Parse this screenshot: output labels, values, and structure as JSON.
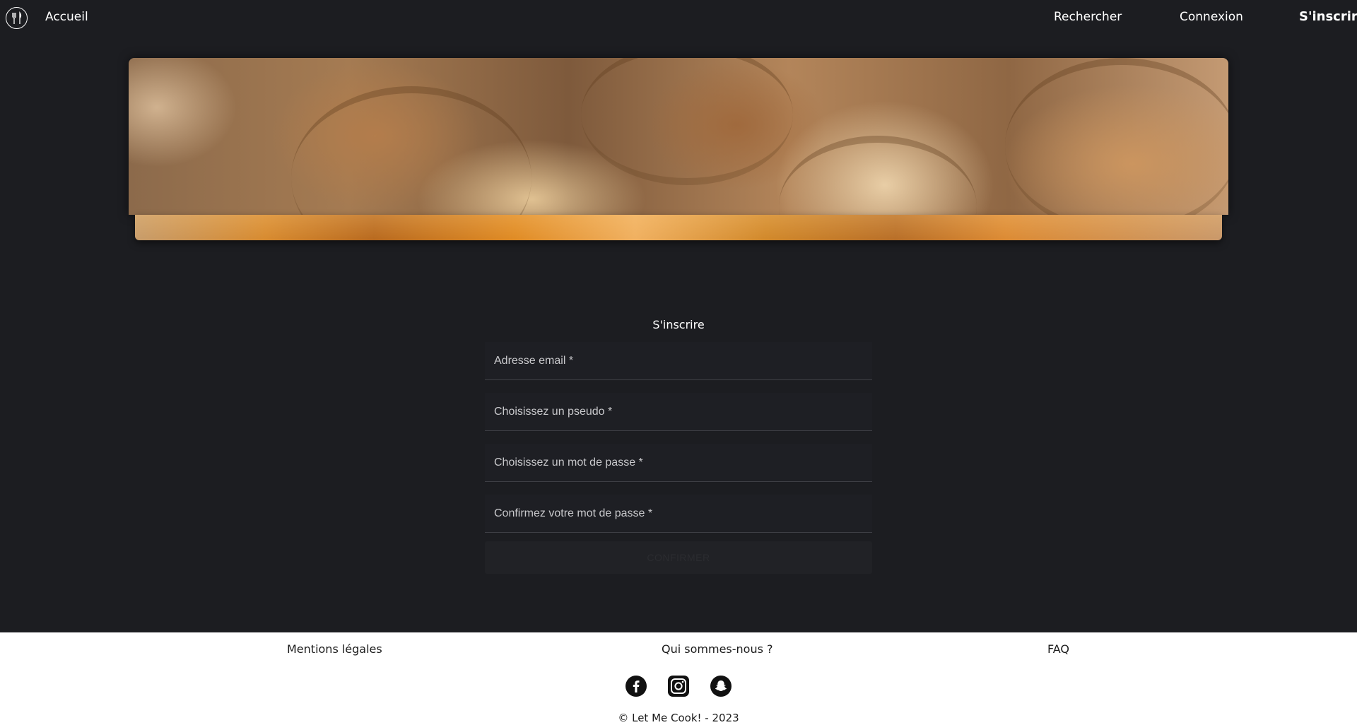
{
  "nav": {
    "logo_icon": "fork-knife-icon",
    "home_label": "Accueil",
    "search_label": "Rechercher",
    "login_label": "Connexion",
    "signup_label": "S'inscrire"
  },
  "banner": {
    "image": "croissants-banner"
  },
  "form": {
    "title": "S'inscrire",
    "email_placeholder": "Adresse email *",
    "username_placeholder": "Choisissez un pseudo *",
    "password_placeholder": "Choisissez un mot de passe *",
    "confirm_placeholder": "Confirmez votre mot de passe *",
    "submit_label": "Confirmer"
  },
  "footer": {
    "links": [
      "Mentions légales",
      "Qui sommes-nous ?",
      "FAQ"
    ],
    "social_icons": [
      "facebook-icon",
      "instagram-icon",
      "snapchat-icon"
    ],
    "copyright": "© Let Me Cook! - 2023"
  },
  "colors": {
    "background": "#1c1d21",
    "footer_background": "#ffffff",
    "text": "#ffffff"
  }
}
